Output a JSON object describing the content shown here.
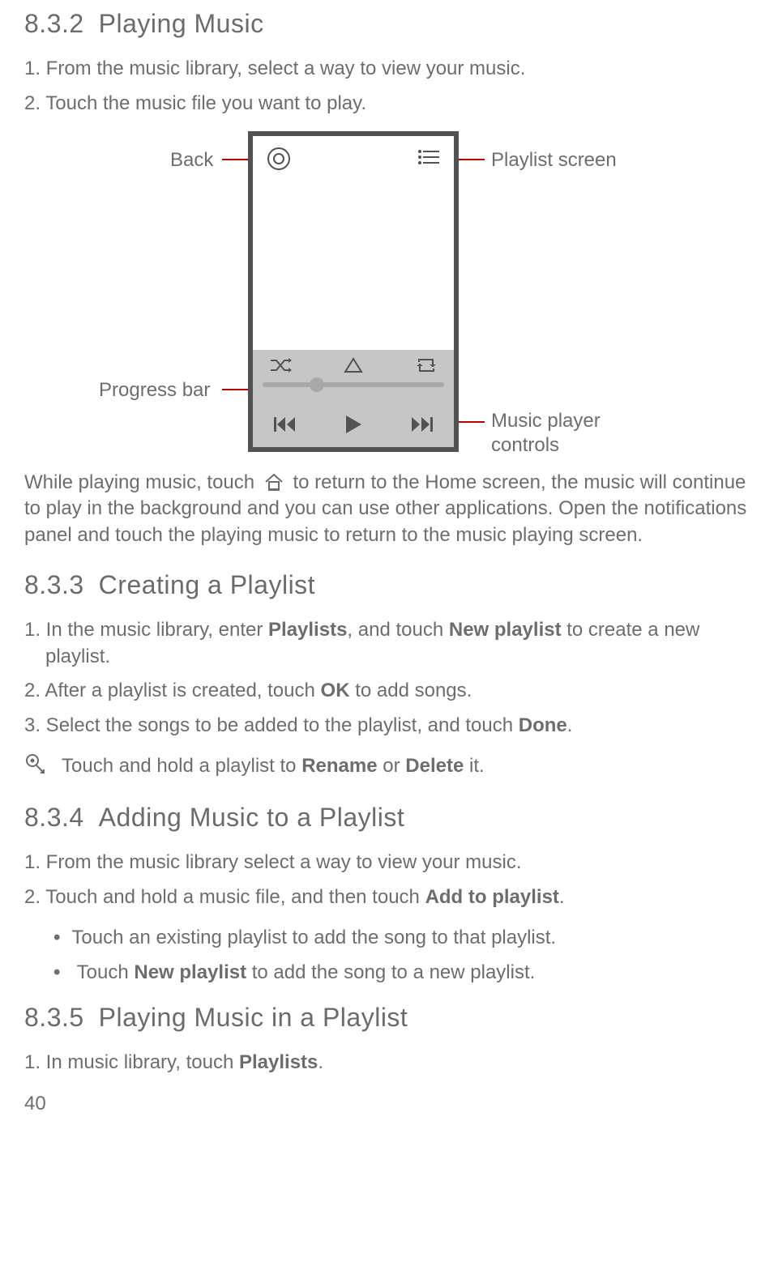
{
  "page_number": "40",
  "sections": {
    "s832": {
      "num": "8.3.2",
      "title": "Playing Music",
      "steps": [
        "1. From the music library, select a way to view your music.",
        "2. Touch the music file you want to play."
      ],
      "figure": {
        "label_back": "Back",
        "label_playlist": "Playlist screen",
        "label_progress": "Progress bar",
        "label_controls_l1": "Music player",
        "label_controls_l2": "controls"
      },
      "after_para_a": "While playing music, touch ",
      "after_para_b": " to return to the Home screen, the music will continue to play in the background and you can use other applications. Open the notifications panel and touch the playing music to return to the music playing screen."
    },
    "s833": {
      "num": "8.3.3",
      "title": "Creating a Playlist",
      "step1_a": "1. In the music library, enter ",
      "step1_b1": "Playlists",
      "step1_c": ", and touch ",
      "step1_b2": "New playlist",
      "step1_d": " to create a new playlist.",
      "step2_a": "2. After a playlist is created, touch ",
      "step2_b": "OK",
      "step2_c": " to add songs.",
      "step3_a": "3. Select the songs to be added to the playlist, and touch ",
      "step3_b": "Done",
      "step3_c": ".",
      "tip_a": "Touch and hold a playlist to ",
      "tip_b1": "Rename",
      "tip_mid": " or ",
      "tip_b2": "Delete",
      "tip_c": " it."
    },
    "s834": {
      "num": "8.3.4",
      "title": "Adding Music to a Playlist",
      "step1": "1. From the music library select a way to view your music.",
      "step2_a": "2. Touch and hold a music file, and then touch ",
      "step2_b": "Add to playlist",
      "step2_c": ".",
      "bullet1": "Touch an existing playlist to add the song to that playlist.",
      "bullet2_a": "Touch ",
      "bullet2_b": "New playlist",
      "bullet2_c": " to add the song to a new playlist."
    },
    "s835": {
      "num": "8.3.5",
      "title": "Playing Music in a Playlist",
      "step1_a": "1. In music library, touch ",
      "step1_b": "Playlists",
      "step1_c": "."
    }
  }
}
